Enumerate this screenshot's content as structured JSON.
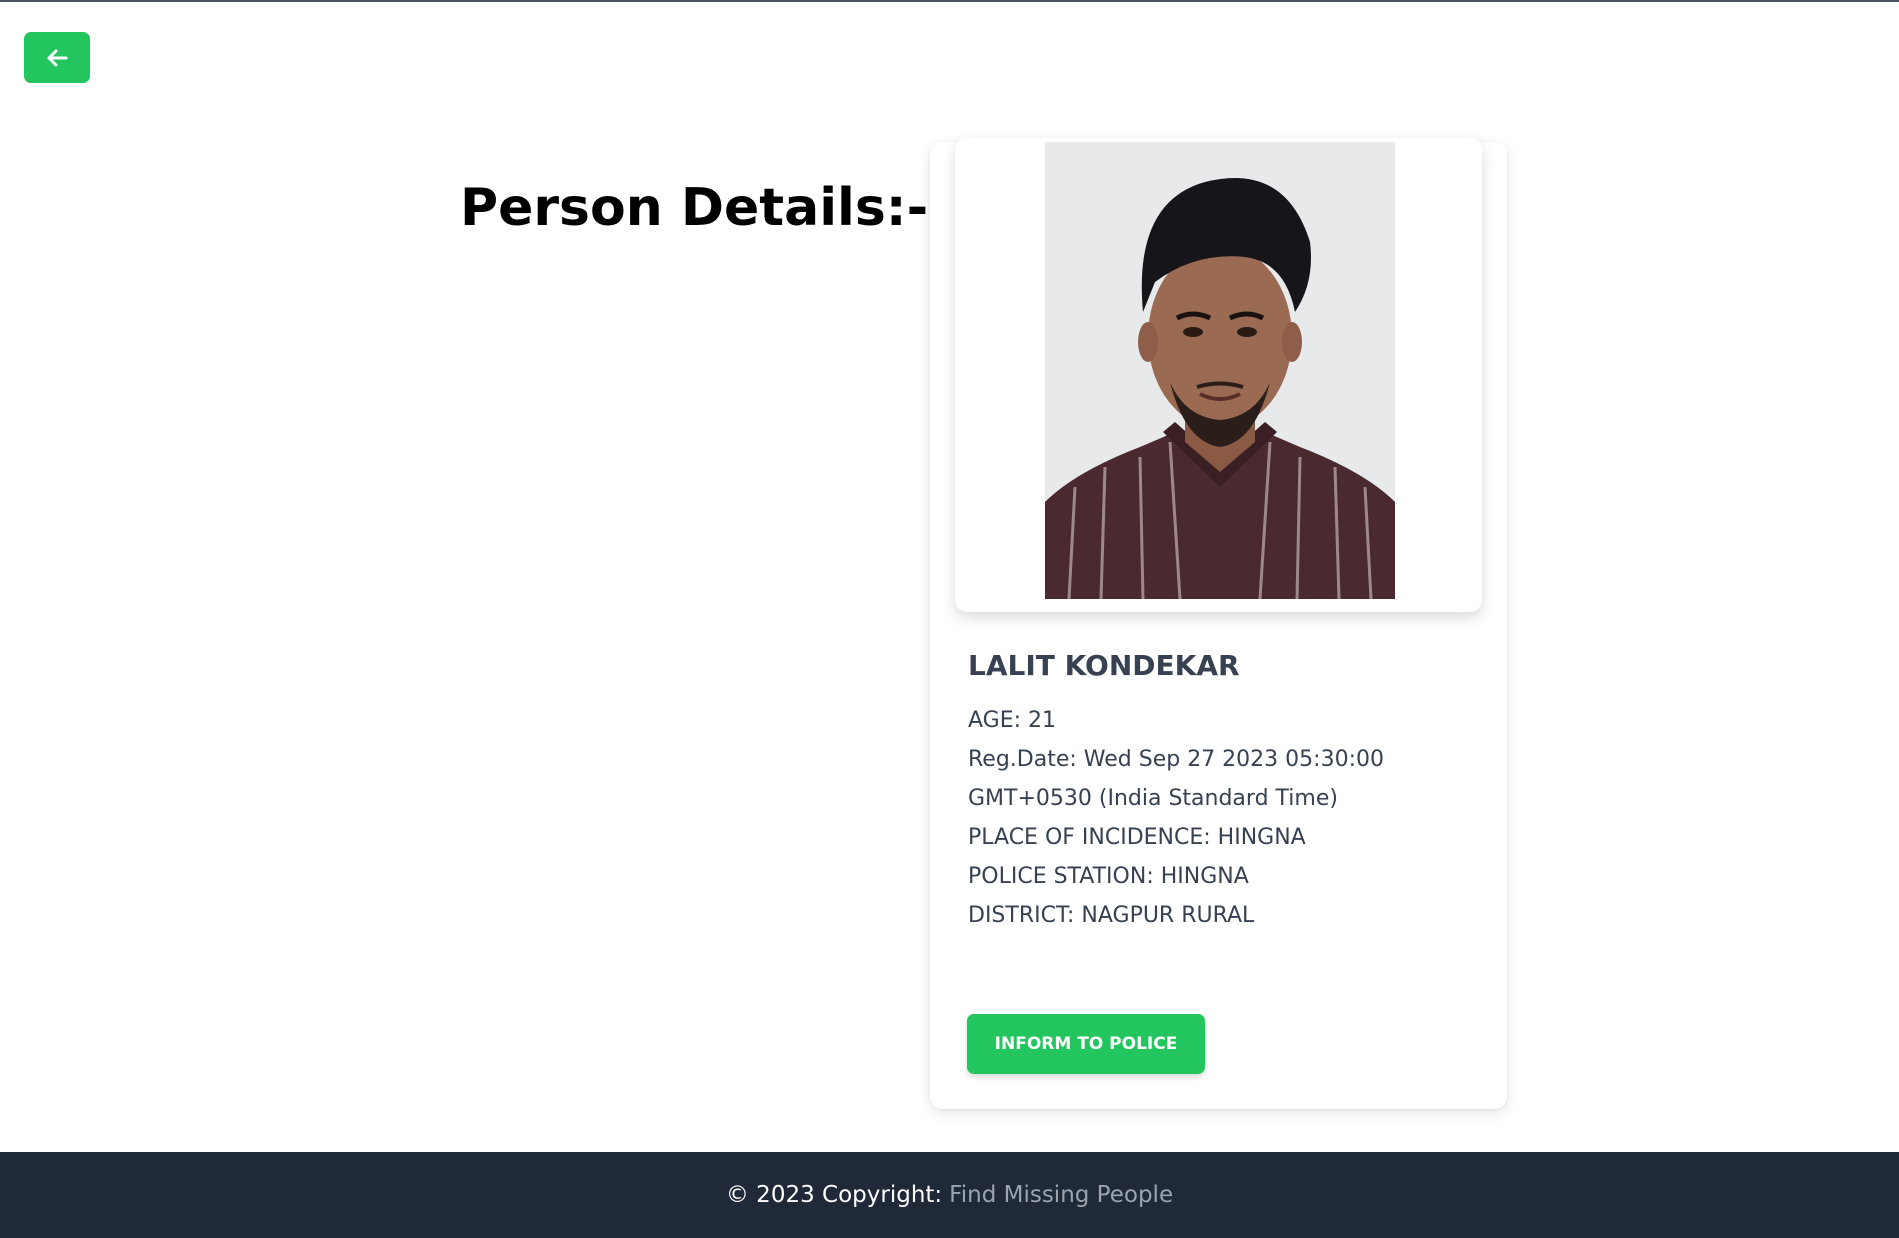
{
  "header": {
    "back_icon": "arrow-left-icon"
  },
  "page": {
    "title": "Person Details:-"
  },
  "person": {
    "photo_alt": "Photo of LALIT KONDEKAR",
    "name": "LALIT KONDEKAR",
    "age": "AGE: 21",
    "reg_date_line1": "Reg.Date: Wed Sep 27 2023 05:30:00",
    "reg_date_line2": "GMT+0530 (India Standard Time)",
    "place": "PLACE OF INCIDENCE: HINGNA",
    "police_station": "POLICE STATION: HINGNA",
    "district": "DISTRICT: NAGPUR RURAL"
  },
  "actions": {
    "inform_label": "INFORM TO POLICE"
  },
  "footer": {
    "copyright": "© 2023 Copyright:",
    "link": "Find Missing People"
  },
  "colors": {
    "accent": "#22c55e",
    "footer_bg": "#1f2937",
    "text": "#374151",
    "footer_link": "#9ca3af"
  }
}
